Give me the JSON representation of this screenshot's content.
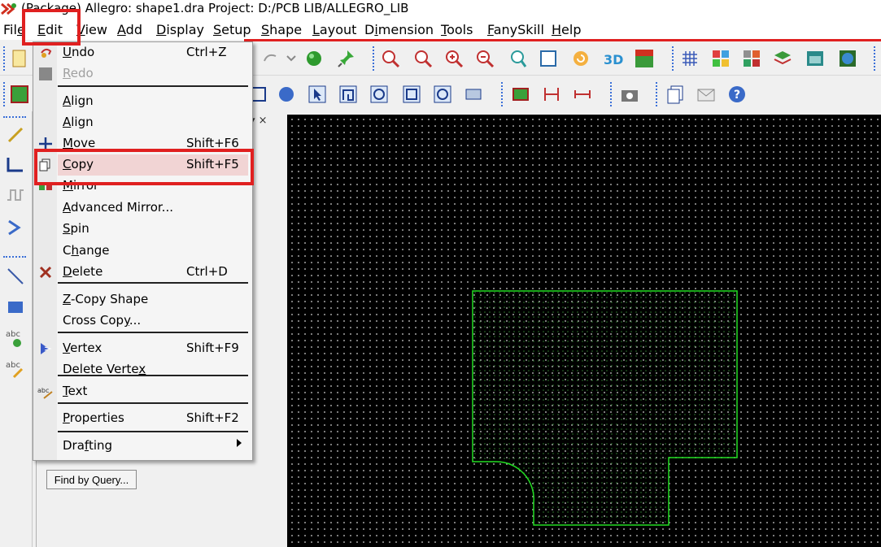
{
  "window": {
    "title": "(Package) Allegro: shape1.dra  Project: D:/PCB LIB/ALLEGRO_LIB"
  },
  "menubar": {
    "items": [
      {
        "pre": "Fil",
        "u": "e",
        "post": ""
      },
      {
        "pre": "",
        "u": "E",
        "post": "dit"
      },
      {
        "pre": "",
        "u": "V",
        "post": "iew"
      },
      {
        "pre": "",
        "u": "A",
        "post": "dd"
      },
      {
        "pre": "",
        "u": "D",
        "post": "isplay"
      },
      {
        "pre": "",
        "u": "S",
        "post": "etup"
      },
      {
        "pre": "",
        "u": "S",
        "post": "hape"
      },
      {
        "pre": "",
        "u": "L",
        "post": "ayout"
      },
      {
        "pre": "D",
        "u": "i",
        "post": "mension"
      },
      {
        "pre": "",
        "u": "T",
        "post": "ools"
      },
      {
        "pre": "",
        "u": "F",
        "post": "anySkill"
      },
      {
        "pre": "",
        "u": "H",
        "post": "elp"
      }
    ]
  },
  "edit_menu": {
    "items": [
      {
        "label_pre": "",
        "label_u": "U",
        "label_post": "ndo",
        "shortcut": "Ctrl+Z",
        "enabled": true,
        "icon": "undo-icon"
      },
      {
        "label_pre": "",
        "label_u": "R",
        "label_post": "edo",
        "shortcut": "",
        "enabled": false,
        "icon": "redo-icon"
      },
      {
        "label_pre": "",
        "label_u": "A",
        "label_post": "lign",
        "shortcut": "",
        "enabled": true,
        "icon": ""
      },
      {
        "label_pre": "",
        "label_u": "A",
        "label_post": "lign",
        "shortcut": "",
        "enabled": true,
        "icon": ""
      },
      {
        "label_pre": "",
        "label_u": "M",
        "label_post": "ove",
        "shortcut": "Shift+F6",
        "enabled": true,
        "icon": "move-icon"
      },
      {
        "label_pre": "",
        "label_u": "C",
        "label_post": "opy",
        "shortcut": "Shift+F5",
        "enabled": true,
        "icon": "copy-icon"
      },
      {
        "label_pre": "",
        "label_u": "M",
        "label_post": "irror",
        "shortcut": "",
        "enabled": true,
        "icon": "mirror-icon"
      },
      {
        "label_pre": "",
        "label_u": "A",
        "label_post": "dvanced Mirror...",
        "shortcut": "",
        "enabled": true,
        "icon": ""
      },
      {
        "label_pre": "",
        "label_u": "S",
        "label_post": "pin",
        "shortcut": "",
        "enabled": true,
        "icon": ""
      },
      {
        "label_pre": "C",
        "label_u": "h",
        "label_post": "ange",
        "shortcut": "",
        "enabled": true,
        "icon": ""
      },
      {
        "label_pre": "",
        "label_u": "D",
        "label_post": "elete",
        "shortcut": "Ctrl+D",
        "enabled": true,
        "icon": "delete-icon"
      },
      {
        "label_pre": "",
        "label_u": "Z",
        "label_post": "-Copy Shape",
        "shortcut": "",
        "enabled": true,
        "icon": ""
      },
      {
        "label_pre": "Cross Cop",
        "label_u": "y",
        "label_post": "...",
        "shortcut": "",
        "enabled": true,
        "icon": ""
      },
      {
        "label_pre": "",
        "label_u": "V",
        "label_post": "ertex",
        "shortcut": "Shift+F9",
        "enabled": true,
        "icon": "vertex-icon"
      },
      {
        "label_pre": "Delete Verte",
        "label_u": "x",
        "label_post": "",
        "shortcut": "",
        "enabled": true,
        "icon": ""
      },
      {
        "label_pre": "",
        "label_u": "T",
        "label_post": "ext",
        "shortcut": "",
        "enabled": true,
        "icon": "text-icon"
      },
      {
        "label_pre": "",
        "label_u": "P",
        "label_post": "roperties",
        "shortcut": "Shift+F2",
        "enabled": true,
        "icon": ""
      },
      {
        "label_pre": "Dra",
        "label_u": "f",
        "label_post": "ting",
        "shortcut": "",
        "enabled": true,
        "icon": "",
        "submenu": true
      }
    ]
  },
  "options_panel": {
    "header_controls": "▾ ×",
    "find_button": "Find by Query..."
  },
  "colors": {
    "highlight_box": "#e02020",
    "shape_outline": "#22dd22",
    "canvas_bg": "#000000"
  }
}
